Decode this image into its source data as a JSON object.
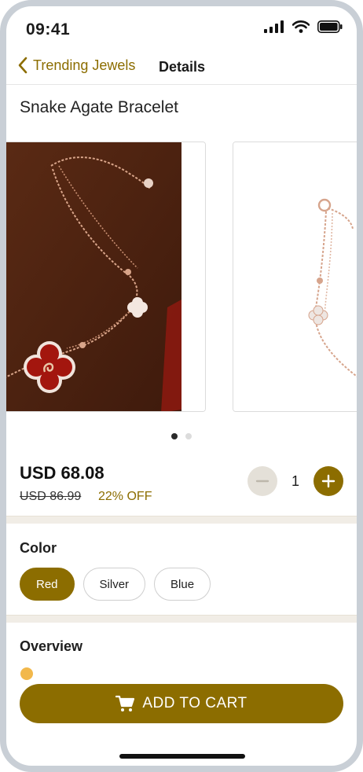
{
  "status": {
    "time": "09:41"
  },
  "nav": {
    "back_label": "Trending Jewels",
    "title": "Details"
  },
  "product": {
    "title": "Snake Agate Bracelet",
    "price": "USD 68.08",
    "old_price": "USD 86.99",
    "discount": "22% OFF",
    "quantity": "1",
    "images_count": 2,
    "active_image": 1
  },
  "color": {
    "section_title": "Color",
    "options": [
      "Red",
      "Silver",
      "Blue"
    ],
    "selected": "Red"
  },
  "overview": {
    "section_title": "Overview"
  },
  "cart": {
    "label": "ADD TO CART"
  },
  "colors": {
    "accent": "#8c6d00",
    "divider": "#f1ede6"
  },
  "icons": [
    "signal-icon",
    "wifi-icon",
    "battery-icon",
    "chevron-left-icon",
    "minus-icon",
    "plus-icon",
    "cart-icon",
    "emoji-icon"
  ]
}
